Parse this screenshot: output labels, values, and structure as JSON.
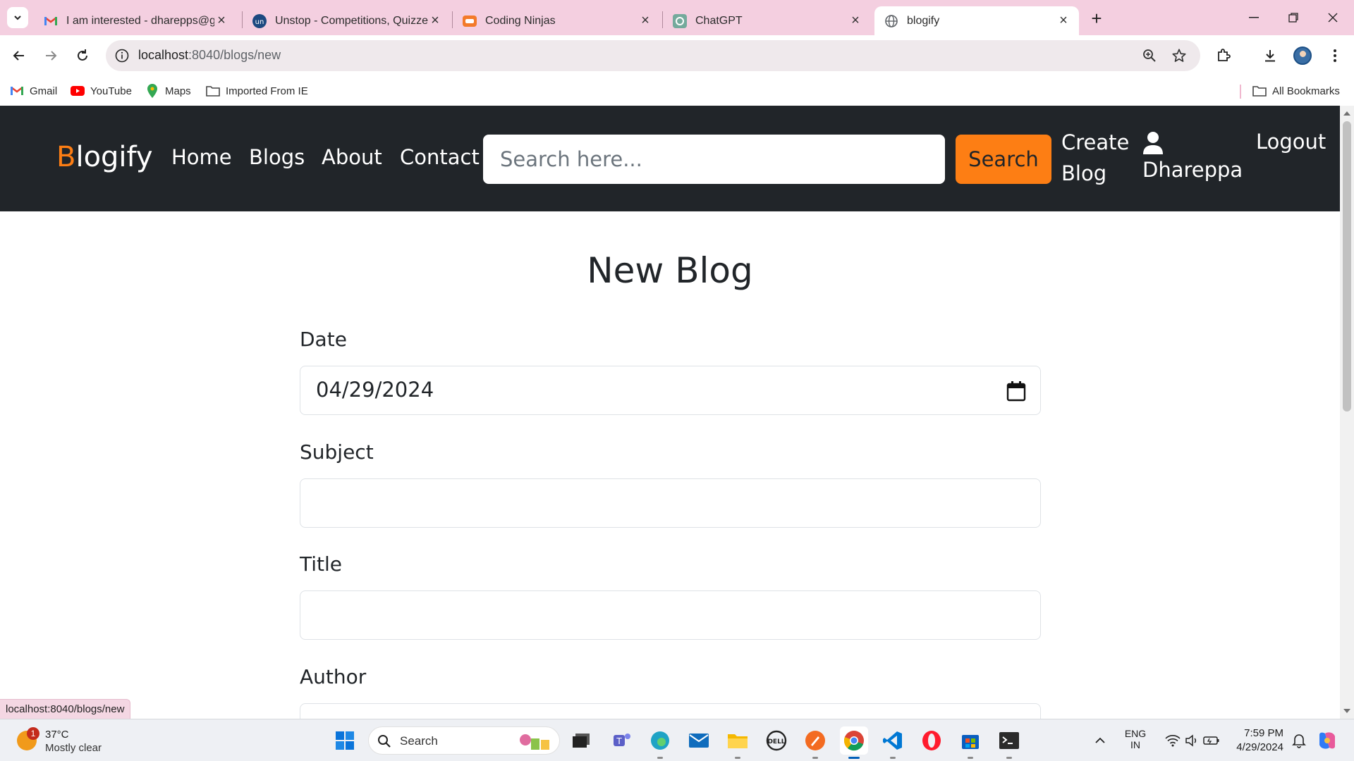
{
  "browser": {
    "tabs": [
      {
        "title": "I am interested - dharepps@gmail.com",
        "icon": "gmail-icon",
        "active": false
      },
      {
        "title": "Unstop - Competitions, Quizzes",
        "icon": "unstop-icon",
        "active": false
      },
      {
        "title": "Coding Ninjas",
        "icon": "coding-ninjas-icon",
        "active": false
      },
      {
        "title": "ChatGPT",
        "icon": "chatgpt-icon",
        "active": false
      },
      {
        "title": "blogify",
        "icon": "globe-icon",
        "active": true
      }
    ],
    "address": {
      "host": "localhost",
      "path": ":8040/blogs/new"
    },
    "bookmarks": [
      {
        "label": "Gmail",
        "icon": "gmail-icon"
      },
      {
        "label": "YouTube",
        "icon": "youtube-icon"
      },
      {
        "label": "Maps",
        "icon": "maps-pin-icon"
      },
      {
        "label": "Imported From IE",
        "icon": "folder-icon"
      }
    ],
    "all_bookmarks": "All Bookmarks",
    "status_url": "localhost:8040/blogs/new"
  },
  "site": {
    "brand_first": "B",
    "brand_rest": "logify",
    "nav": [
      "Home",
      "Blogs",
      "About",
      "Contact"
    ],
    "search_placeholder": "Search here...",
    "search_button": "Search",
    "create_blog_line1": "Create",
    "create_blog_line2": "Blog",
    "user_name": "Dhareppa",
    "logout": "Logout",
    "accent_color": "#fd7e14",
    "nav_bg": "#212529"
  },
  "form": {
    "title": "New Blog",
    "date_label": "Date",
    "date_value": "04/29/2024",
    "subject_label": "Subject",
    "subject_value": "",
    "title_label": "Title",
    "title_value": "",
    "author_label": "Author"
  },
  "taskbar": {
    "weather_temp": "37°C",
    "weather_desc": "Mostly clear",
    "weather_badge": "1",
    "search_label": "Search",
    "lang_line1": "ENG",
    "lang_line2": "IN",
    "time": "7:59 PM",
    "date": "4/29/2024"
  }
}
